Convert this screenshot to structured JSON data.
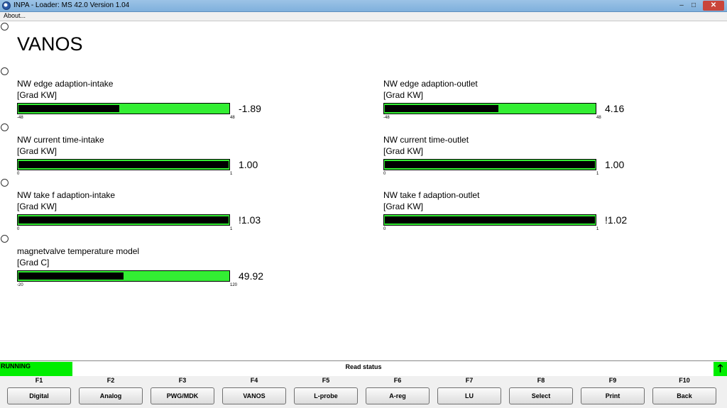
{
  "window": {
    "title": "INPA - Loader:  MS 42.0 Version 1.04",
    "minimize_glyph": "–",
    "maximize_glyph": "□",
    "close_glyph": "✕"
  },
  "menu": {
    "about_label": "About..."
  },
  "page": {
    "title": "VANOS"
  },
  "gauges": [
    {
      "label": "NW edge adaption-intake",
      "unit": "[Grad KW]",
      "value_text": "-1.89",
      "min": "-48",
      "max": "48",
      "fill_fraction": 0.48
    },
    {
      "label": "NW edge adaption-outlet",
      "unit": "[Grad KW]",
      "value_text": "4.16",
      "min": "-48",
      "max": "48",
      "fill_fraction": 0.54
    },
    {
      "label": "NW current time-intake",
      "unit": "[Grad KW]",
      "value_text": "1.00",
      "min": "0",
      "max": "1",
      "fill_fraction": 1.0
    },
    {
      "label": "NW current time-outlet",
      "unit": "[Grad KW]",
      "value_text": "1.00",
      "min": "0",
      "max": "1",
      "fill_fraction": 1.0
    },
    {
      "label": "NW take f adaption-intake",
      "unit": "[Grad KW]",
      "value_text": "!1.03",
      "min": "0",
      "max": "1",
      "fill_fraction": 1.0
    },
    {
      "label": "NW take f adaption-outlet",
      "unit": "[Grad KW]",
      "value_text": "!1.02",
      "min": "0",
      "max": "1",
      "fill_fraction": 1.0
    },
    {
      "label": "magnetvalve temperature model",
      "unit": "[Grad C]",
      "value_text": "49.92",
      "min": "-20",
      "max": "120",
      "fill_fraction": 0.5
    }
  ],
  "status": {
    "state_label": "RUNNING",
    "message": "Read status",
    "arrow_glyph": "🡑",
    "colors": {
      "active": "#00ee00",
      "bar_bg": "#33ee33",
      "bar_fill": "#000000"
    }
  },
  "function_keys": [
    {
      "key": "F1",
      "label": "Digital"
    },
    {
      "key": "F2",
      "label": "Analog"
    },
    {
      "key": "F3",
      "label": "PWG/MDK"
    },
    {
      "key": "F4",
      "label": "VANOS"
    },
    {
      "key": "F5",
      "label": "L-probe"
    },
    {
      "key": "F6",
      "label": "A-reg"
    },
    {
      "key": "F7",
      "label": "LU"
    },
    {
      "key": "F8",
      "label": "Select"
    },
    {
      "key": "F9",
      "label": "Print"
    },
    {
      "key": "F10",
      "label": "Back"
    }
  ]
}
